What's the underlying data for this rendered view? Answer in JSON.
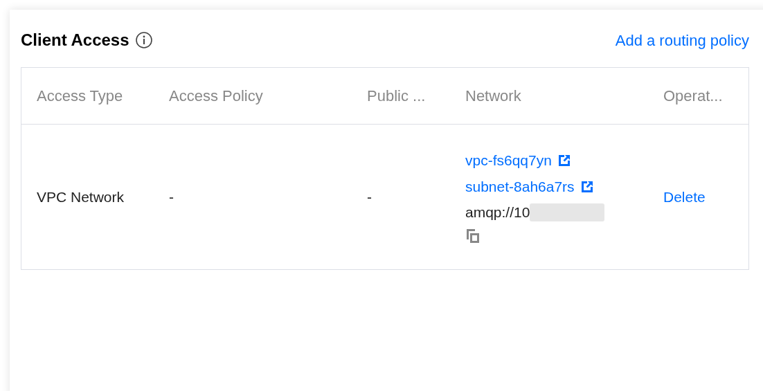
{
  "title": "Client Access",
  "add_link": "Add a routing policy",
  "table": {
    "columns": [
      "Access Type",
      "Access Policy",
      "Public ...",
      "Network",
      "Operat..."
    ],
    "rows": [
      {
        "access_type": "VPC Network",
        "access_policy": "-",
        "public": "-",
        "vpc_link": "vpc-fs6qq7yn",
        "subnet_link": "subnet-8ah6a7rs",
        "address": "amqp://10",
        "operation": "Delete"
      }
    ]
  }
}
